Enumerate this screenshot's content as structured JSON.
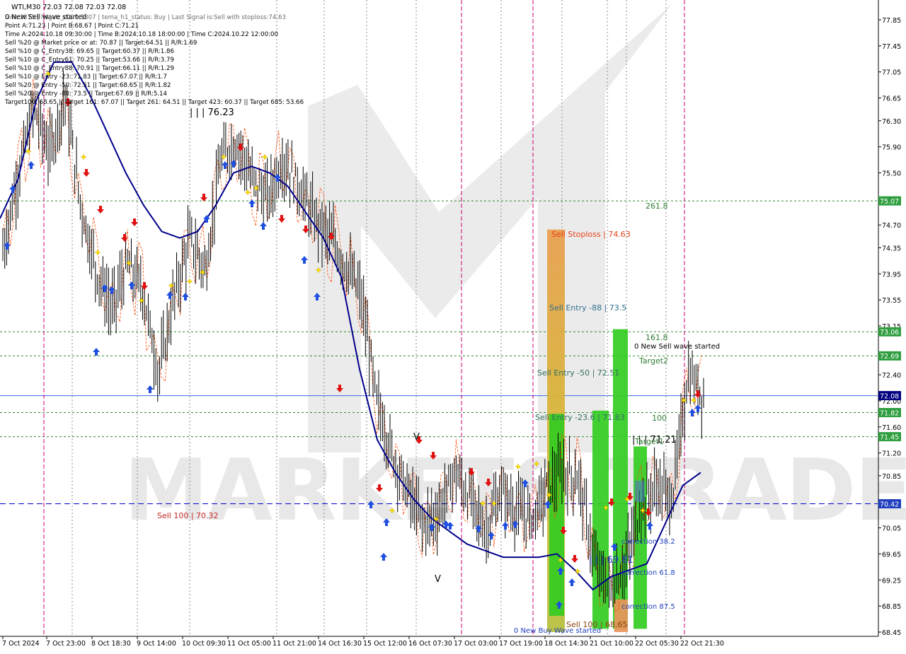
{
  "symbol_header": "WTI,M30  72.03 72.08 72.03 72.08",
  "info_lines": [
    "0 New Sell wave started",
    "Line:3875 | h4_atr_c0: 0.5307 | tema_h1_status: Buy | Last Signal is:Sell with stoploss:74.63",
    "Point A:71.23 | Point B:68.67 | Point C:71.21",
    "Time A:2024.10.18 09:30:00 | Time B:2024.10.18 18:00:00 | Time C:2024.10.22 12:00:00",
    "Sell %20 @ Market price or at: 70.87 || Target:64.51 || R/R:1.69",
    "Sell %10 @ C_Entry38: 69.65 || Target:60.37 || R/R:1.86",
    "Sell %10 @ C_Entry61: 70.25 || Target:53.66 || R/R:3.79",
    "Sell %10 @ C_Entry88: 70.91 || Target:66.11 || R/R:1.29",
    "Sell %10 @ Entry -23: 71.83 || Target:67.07 || R/R:1.7",
    "Sell %20 @ Entry -50: 72.51 || Target:68.65 || R/R:1.82",
    "Sell %20 @ Entry -88: 73.5 || Target:67.69 || R/R:5.14",
    "Target100: 68.65 || Target 161: 67.07 || Target 261: 64.51 || Target 423: 60.37 || Target 685: 53.66"
  ],
  "watermark": "MARKETS TRADE",
  "colors": {
    "background": "#ffffff",
    "candle": "#000000",
    "ma_line": "#00008b",
    "envelope": "#ff4500",
    "grid_green": "#2e8b2e",
    "last_price_line": "#4169e1",
    "dashed_blue": "#0000cd",
    "session_magenta": "#cc0077",
    "price_box_green": "#2f9e3f",
    "price_box_navy": "#000080",
    "price_box_blue": "#1f3fbf",
    "bar_green": "#33cc22",
    "bar_orange": "#e8955a",
    "bar_gold": "#d4b032",
    "arrow_up": "#1f4fe0",
    "arrow_down": "#e01010",
    "signal_yellow": "#ffe000"
  },
  "chart_data": {
    "type": "candlestick",
    "title": "WTI,M30",
    "ylim": [
      68.45,
      77.95
    ],
    "y_ticks": [
      "77.85",
      "77.45",
      "77.05",
      "76.65",
      "76.30",
      "75.90",
      "75.50",
      "75.07",
      "74.70",
      "74.35",
      "73.95",
      "73.55",
      "73.15",
      "73.06",
      "72.69",
      "72.40",
      "72.08",
      "72.00",
      "71.82",
      "71.60",
      "71.45",
      "71.20",
      "70.85",
      "70.42",
      "70.05",
      "69.65",
      "69.25",
      "68.85",
      "68.45"
    ],
    "x_ticks": [
      "7 Oct 2024",
      "7 Oct 23:00",
      "8 Oct 18:30",
      "9 Oct 14:00",
      "10 Oct 09:30",
      "11 Oct 05:00",
      "11 Oct 21:00",
      "14 Oct 16:30",
      "15 Oct 12:00",
      "16 Oct 07:30",
      "17 Oct 03:00",
      "17 Oct 19:00",
      "18 Oct 14:30",
      "21 Oct 10:00",
      "22 Oct 05:30",
      "22 Oct 21:30"
    ],
    "last_price": 72.08,
    "price_close_approx": [
      74.3,
      75.5,
      76.5,
      75.8,
      76.7,
      75.0,
      74.0,
      73.4,
      74.1,
      73.7,
      72.4,
      73.6,
      74.5,
      74.0,
      75.7,
      76.0,
      75.4,
      75.1,
      75.7,
      75.3,
      74.8,
      74.5,
      74.1,
      73.6,
      72.0,
      71.2,
      70.6,
      70.1,
      70.3,
      70.9,
      70.5,
      70.0,
      70.6,
      70.3,
      70.2,
      70.7,
      70.9,
      70.8,
      69.5,
      69.1,
      69.5,
      70.4,
      70.7,
      70.5,
      72.4,
      72.08
    ],
    "ma_values_approx": [
      74.8,
      75.4,
      76.6,
      77.2,
      77.2,
      76.7,
      76.1,
      75.5,
      75.0,
      74.6,
      74.5,
      74.6,
      75.0,
      75.5,
      75.6,
      75.5,
      75.3,
      74.9,
      74.5,
      73.9,
      72.5,
      71.4,
      70.9,
      70.5,
      70.2,
      70.0,
      69.8,
      69.7,
      69.6,
      69.6,
      69.6,
      69.65,
      69.4,
      69.1,
      69.3,
      69.4,
      69.5,
      70.1,
      70.7,
      70.9
    ],
    "horizontal_levels": [
      {
        "price": 75.07,
        "label": "261.8",
        "style": "green-dotted",
        "box": "75.07"
      },
      {
        "price": 73.06,
        "label": "161.8",
        "style": "green-dotted",
        "box": "73.06"
      },
      {
        "price": 72.69,
        "label": "Target2",
        "style": "green-dotted",
        "box": "72.69"
      },
      {
        "price": 72.08,
        "label": "",
        "style": "blue-solid",
        "box": "72.08"
      },
      {
        "price": 71.82,
        "label": "100",
        "style": "green-dotted",
        "box": "71.82"
      },
      {
        "price": 71.45,
        "label": "Target1",
        "style": "green-dotted",
        "box": "71.45"
      },
      {
        "price": 70.42,
        "label": "",
        "style": "blue-dashed",
        "box": "70.42"
      }
    ],
    "annotations": [
      {
        "text": "Sell Stoploss | 74.63",
        "color": "#e8421a"
      },
      {
        "text": "Sell Entry -88 | 73.5",
        "color": "#2f6f8f"
      },
      {
        "text": "Sell Entry -50 | 72.51",
        "color": "#2f6f5f"
      },
      {
        "text": "Sell Entry -23.6 | 71.83",
        "color": "#2f6f5f"
      },
      {
        "text": "Sell 100 | 70.32",
        "color": "#c62828"
      },
      {
        "text": "Sell 100 | 68.65",
        "color": "#8b4513"
      },
      {
        "text": "0 New Sell wave started",
        "color": "#000000"
      },
      {
        "text": "0 New Buy Wave started",
        "color": "#1f3fbf"
      },
      {
        "text": "correction 38.2",
        "color": "#1f3fbf"
      },
      {
        "text": "correction 61.8",
        "color": "#1f3fbf"
      },
      {
        "text": "correction 87.5",
        "color": "#1f3fbf"
      },
      {
        "text": "| | | 76.23",
        "color": "#000000"
      },
      {
        "text": "| | | 71.21",
        "color": "#000000"
      },
      {
        "text": "| | | 69.81",
        "color": "#1f3fbf"
      },
      {
        "text": "V",
        "color": "#000000"
      },
      {
        "text": "V",
        "color": "#000000"
      },
      {
        "text": "261.8",
        "color": "#2e7d32"
      },
      {
        "text": "161.8",
        "color": "#2e7d32"
      },
      {
        "text": "Target2",
        "color": "#2e7d32"
      },
      {
        "text": "100",
        "color": "#2e7d32"
      },
      {
        "text": "Target1",
        "color": "#2e7d32"
      }
    ],
    "vertical_bars": [
      {
        "name": "gold-stoploss-bar",
        "from": 68.45,
        "to": 74.63,
        "color": "#d4b032"
      },
      {
        "name": "green-bar-1",
        "from": 68.7,
        "to": 71.8,
        "color": "#33cc22"
      },
      {
        "name": "green-bar-2",
        "from": 68.5,
        "to": 71.85,
        "color": "#33cc22"
      },
      {
        "name": "green-bar-3",
        "from": 68.5,
        "to": 73.1,
        "color": "#33cc22"
      },
      {
        "name": "orange-bar",
        "from": 68.45,
        "to": 68.95,
        "color": "#e8955a"
      },
      {
        "name": "green-bar-4",
        "from": 68.5,
        "to": 71.3,
        "color": "#33cc22"
      }
    ]
  }
}
